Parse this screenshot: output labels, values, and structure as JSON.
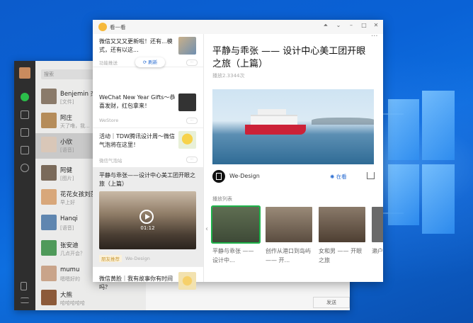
{
  "wechat": {
    "search_placeholder": "搜索",
    "send_label": "发送",
    "chats": [
      {
        "name": "Benjemin 杰",
        "msg": "[文件]"
      },
      {
        "name": "阿庄",
        "msg": "天了噜，我..."
      },
      {
        "name": "小欣",
        "msg": "[语音]"
      },
      {
        "name": "阿健",
        "msg": "[图片]"
      },
      {
        "name": "花花女孩刘莎",
        "msg": "早上好"
      },
      {
        "name": "Hanqi",
        "msg": "[语音]"
      },
      {
        "name": "张安迪",
        "msg": "几点开会？"
      },
      {
        "name": "mumu",
        "msg": "嗯嗯好的"
      },
      {
        "name": "大熊",
        "msg": "哈哈哈哈哈"
      }
    ]
  },
  "top_stories": {
    "app_title": "看一看",
    "refresh_label": "刷新",
    "articles": [
      {
        "title": "微信又又又更新啦！还有...模式，还有以这...",
        "source": "功能推送"
      },
      {
        "title": "WeChat New Year Gifts～恭喜发财，红包拿来！",
        "source": "WeStore"
      },
      {
        "title": "活动｜TDW腾讯设计周～微信气泡将在这里！",
        "source": "微信气泡站"
      },
      {
        "title": "平静与乖张——设计中心美工团开眼之旅（上篇）",
        "source": "We-Design",
        "tag": "朋友推荐",
        "duration": "01:12"
      },
      {
        "title": "微信黄脸｜我有故事你有时间吗？",
        "source": ""
      }
    ],
    "detail": {
      "title": "平静与乖张 —— 设计中心美工团开眼之旅（上篇）",
      "views": "播放2.3344次",
      "author": "We-Design",
      "watch_label": "在看",
      "playlist_label": "播放列表",
      "playlist": [
        {
          "caption": "平静与乖张 —— 设计中..."
        },
        {
          "caption": "创作从港口到岛屿 —— 开..."
        },
        {
          "caption": "女和男 —— 开眼之旅"
        },
        {
          "caption": "濑户"
        }
      ]
    }
  },
  "colors": {
    "accent_green": "#1fb24b",
    "link_blue": "#2b6ed2",
    "ferry_red": "#cc2238"
  }
}
